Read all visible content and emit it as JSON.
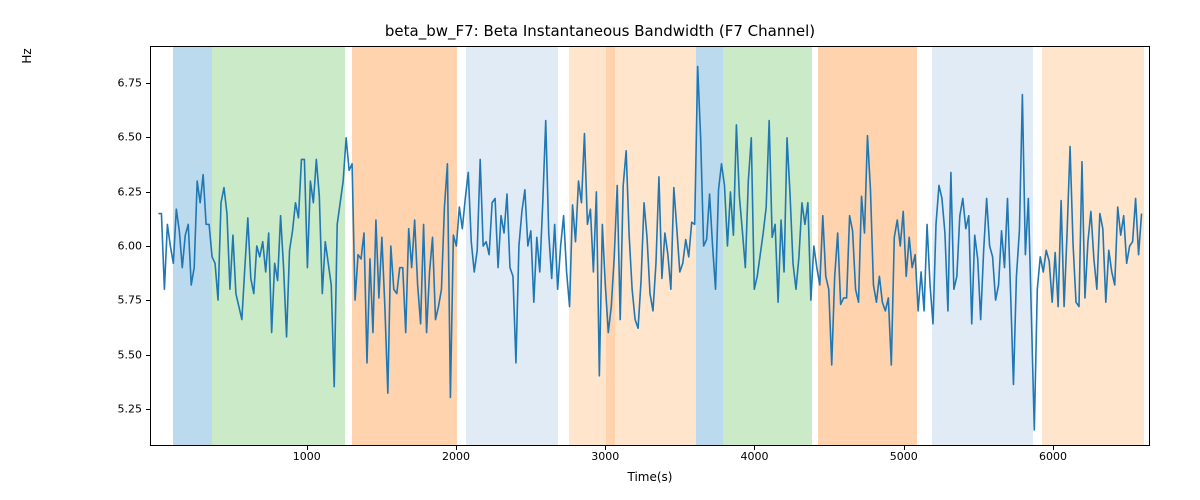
{
  "chart_data": {
    "type": "line",
    "title": "beta_bw_F7: Beta Instantaneous Bandwidth (F7 Channel)",
    "xlabel": "Time(s)",
    "ylabel": "Hz",
    "xlim": [
      -50,
      6650
    ],
    "ylim": [
      5.08,
      6.92
    ],
    "yticks": [
      5.25,
      5.5,
      5.75,
      6.0,
      6.25,
      6.5,
      6.75
    ],
    "xticks": [
      1000,
      2000,
      3000,
      4000,
      5000,
      6000
    ],
    "line_color": "#1f77b4",
    "bands": [
      {
        "start": 100,
        "end": 360,
        "color": "#6baed6",
        "alpha": 0.45
      },
      {
        "start": 360,
        "end": 1250,
        "color": "#a1d99b",
        "alpha": 0.55
      },
      {
        "start": 1300,
        "end": 2000,
        "color": "#fdae6b",
        "alpha": 0.55
      },
      {
        "start": 2060,
        "end": 2680,
        "color": "#c6dbef",
        "alpha": 0.55
      },
      {
        "start": 2750,
        "end": 3000,
        "color": "#fdd0a2",
        "alpha": 0.55
      },
      {
        "start": 3000,
        "end": 3060,
        "color": "#fdae6b",
        "alpha": 0.55
      },
      {
        "start": 3060,
        "end": 3600,
        "color": "#fdd0a2",
        "alpha": 0.55
      },
      {
        "start": 3600,
        "end": 3780,
        "color": "#6baed6",
        "alpha": 0.45
      },
      {
        "start": 3780,
        "end": 4380,
        "color": "#a1d99b",
        "alpha": 0.55
      },
      {
        "start": 4420,
        "end": 5080,
        "color": "#fdae6b",
        "alpha": 0.55
      },
      {
        "start": 5180,
        "end": 5860,
        "color": "#c6dbef",
        "alpha": 0.55
      },
      {
        "start": 5920,
        "end": 6600,
        "color": "#fdd0a2",
        "alpha": 0.55
      }
    ],
    "x": [
      0,
      20,
      40,
      60,
      80,
      100,
      120,
      140,
      160,
      180,
      200,
      220,
      240,
      260,
      280,
      300,
      320,
      340,
      360,
      380,
      400,
      420,
      440,
      460,
      480,
      500,
      520,
      540,
      560,
      580,
      600,
      620,
      640,
      660,
      680,
      700,
      720,
      740,
      760,
      780,
      800,
      820,
      840,
      860,
      880,
      900,
      920,
      940,
      960,
      980,
      1000,
      1020,
      1040,
      1060,
      1080,
      1100,
      1120,
      1140,
      1160,
      1180,
      1200,
      1220,
      1240,
      1260,
      1280,
      1300,
      1320,
      1340,
      1360,
      1380,
      1400,
      1420,
      1440,
      1460,
      1480,
      1500,
      1520,
      1540,
      1560,
      1580,
      1600,
      1620,
      1640,
      1660,
      1680,
      1700,
      1720,
      1740,
      1760,
      1780,
      1800,
      1820,
      1840,
      1860,
      1880,
      1900,
      1920,
      1940,
      1960,
      1980,
      2000,
      2020,
      2040,
      2060,
      2080,
      2100,
      2120,
      2140,
      2160,
      2180,
      2200,
      2220,
      2240,
      2260,
      2280,
      2300,
      2320,
      2340,
      2360,
      2380,
      2400,
      2420,
      2440,
      2460,
      2480,
      2500,
      2520,
      2540,
      2560,
      2580,
      2600,
      2620,
      2640,
      2660,
      2680,
      2700,
      2720,
      2740,
      2760,
      2780,
      2800,
      2820,
      2840,
      2860,
      2880,
      2900,
      2920,
      2940,
      2960,
      2980,
      3000,
      3020,
      3040,
      3060,
      3080,
      3100,
      3120,
      3140,
      3160,
      3180,
      3200,
      3220,
      3240,
      3260,
      3280,
      3300,
      3320,
      3340,
      3360,
      3380,
      3400,
      3420,
      3440,
      3460,
      3480,
      3500,
      3520,
      3540,
      3560,
      3580,
      3600,
      3620,
      3640,
      3660,
      3680,
      3700,
      3720,
      3740,
      3760,
      3780,
      3800,
      3820,
      3840,
      3860,
      3880,
      3900,
      3920,
      3940,
      3960,
      3980,
      4000,
      4020,
      4040,
      4060,
      4080,
      4100,
      4120,
      4140,
      4160,
      4180,
      4200,
      4220,
      4240,
      4260,
      4280,
      4300,
      4320,
      4340,
      4360,
      4380,
      4400,
      4420,
      4440,
      4460,
      4480,
      4500,
      4520,
      4540,
      4560,
      4580,
      4600,
      4620,
      4640,
      4660,
      4680,
      4700,
      4720,
      4740,
      4760,
      4780,
      4800,
      4820,
      4840,
      4860,
      4880,
      4900,
      4920,
      4940,
      4960,
      4980,
      5000,
      5020,
      5040,
      5060,
      5080,
      5100,
      5120,
      5140,
      5160,
      5180,
      5200,
      5220,
      5240,
      5260,
      5280,
      5300,
      5320,
      5340,
      5360,
      5380,
      5400,
      5420,
      5440,
      5460,
      5480,
      5500,
      5520,
      5540,
      5560,
      5580,
      5600,
      5620,
      5640,
      5660,
      5680,
      5700,
      5720,
      5740,
      5760,
      5780,
      5800,
      5820,
      5840,
      5860,
      5880,
      5900,
      5920,
      5940,
      5960,
      5980,
      6000,
      6020,
      6040,
      6060,
      6080,
      6100,
      6120,
      6140,
      6160,
      6180,
      6200,
      6220,
      6240,
      6260,
      6280,
      6300,
      6320,
      6340,
      6360,
      6380,
      6400,
      6420,
      6440,
      6460,
      6480,
      6500,
      6520,
      6540,
      6560,
      6580,
      6600
    ],
    "values": [
      6.15,
      6.15,
      5.8,
      6.1,
      6.0,
      5.92,
      6.17,
      6.07,
      5.9,
      6.05,
      6.1,
      5.82,
      5.9,
      6.3,
      6.2,
      6.33,
      6.1,
      6.1,
      5.95,
      5.92,
      5.75,
      6.2,
      6.27,
      6.15,
      5.8,
      6.05,
      5.78,
      5.72,
      5.66,
      5.9,
      6.13,
      5.85,
      5.78,
      6.0,
      5.95,
      6.02,
      5.88,
      6.06,
      5.6,
      5.92,
      5.84,
      6.14,
      5.9,
      5.58,
      5.98,
      6.07,
      6.2,
      6.13,
      6.4,
      6.4,
      5.9,
      6.3,
      6.2,
      6.4,
      6.23,
      5.78,
      6.02,
      5.92,
      5.82,
      5.35,
      6.1,
      6.2,
      6.3,
      6.5,
      6.35,
      6.38,
      5.75,
      5.96,
      5.94,
      6.06,
      5.46,
      5.94,
      5.6,
      6.12,
      5.76,
      6.04,
      5.72,
      5.32,
      6.0,
      5.8,
      5.78,
      5.9,
      5.9,
      5.6,
      6.08,
      5.9,
      6.12,
      5.82,
      5.64,
      6.1,
      5.6,
      5.88,
      6.04,
      5.66,
      5.72,
      5.8,
      6.18,
      6.38,
      5.3,
      6.05,
      6.0,
      6.18,
      6.08,
      6.22,
      6.34,
      6.02,
      5.88,
      5.98,
      6.4,
      6.0,
      6.02,
      5.96,
      6.2,
      6.22,
      5.9,
      6.14,
      6.06,
      6.24,
      5.9,
      5.86,
      5.46,
      6.0,
      6.16,
      6.26,
      6.0,
      6.07,
      5.74,
      6.04,
      5.88,
      6.2,
      6.58,
      6.06,
      5.85,
      6.1,
      5.8,
      6.0,
      6.14,
      5.88,
      5.72,
      6.19,
      6.02,
      6.3,
      6.2,
      6.52,
      6.1,
      6.17,
      5.88,
      6.25,
      5.4,
      6.1,
      5.82,
      5.6,
      5.72,
      5.95,
      6.28,
      5.66,
      6.28,
      6.44,
      6.05,
      5.8,
      5.66,
      5.62,
      5.84,
      6.2,
      6.04,
      5.78,
      5.7,
      5.92,
      6.32,
      5.85,
      6.06,
      5.96,
      5.8,
      6.27,
      6.08,
      5.88,
      5.92,
      6.03,
      5.95,
      6.11,
      6.1,
      6.83,
      6.5,
      6.0,
      6.03,
      6.24,
      6.0,
      5.8,
      6.26,
      6.38,
      6.28,
      6.0,
      6.25,
      6.05,
      6.56,
      6.23,
      6.07,
      5.9,
      6.3,
      6.5,
      5.8,
      5.86,
      5.96,
      6.06,
      6.18,
      6.58,
      6.04,
      6.1,
      5.74,
      6.12,
      5.88,
      6.5,
      6.24,
      5.92,
      5.8,
      5.95,
      6.2,
      6.1,
      6.2,
      5.75,
      6.0,
      5.9,
      5.82,
      6.14,
      5.86,
      5.8,
      5.45,
      5.86,
      6.06,
      5.73,
      5.76,
      5.76,
      6.14,
      6.07,
      5.8,
      5.74,
      6.23,
      6.06,
      6.51,
      6.26,
      5.82,
      5.74,
      5.86,
      5.74,
      5.7,
      5.76,
      5.45,
      6.04,
      6.12,
      6.0,
      6.16,
      5.86,
      6.04,
      5.9,
      5.96,
      5.7,
      5.88,
      5.7,
      6.1,
      5.82,
      5.64,
      6.1,
      6.28,
      6.22,
      6.06,
      5.7,
      6.34,
      5.8,
      5.86,
      6.14,
      6.22,
      6.08,
      6.14,
      5.64,
      6.05,
      5.94,
      5.66,
      5.98,
      6.22,
      6.0,
      5.95,
      5.75,
      5.82,
      6.07,
      5.9,
      6.22,
      5.8,
      5.36,
      5.86,
      6.07,
      6.7,
      5.96,
      6.22,
      5.69,
      5.15,
      5.8,
      5.95,
      5.88,
      5.98,
      5.93,
      5.74,
      5.97,
      5.72,
      6.21,
      5.72,
      6.06,
      6.46,
      6.01,
      5.74,
      5.72,
      6.39,
      5.76,
      6.02,
      6.16,
      5.94,
      5.8,
      6.15,
      6.08,
      5.74,
      5.98,
      5.88,
      5.82,
      6.18,
      6.05,
      6.14,
      5.92,
      6.0,
      6.02,
      6.22,
      5.96,
      6.15
    ]
  }
}
